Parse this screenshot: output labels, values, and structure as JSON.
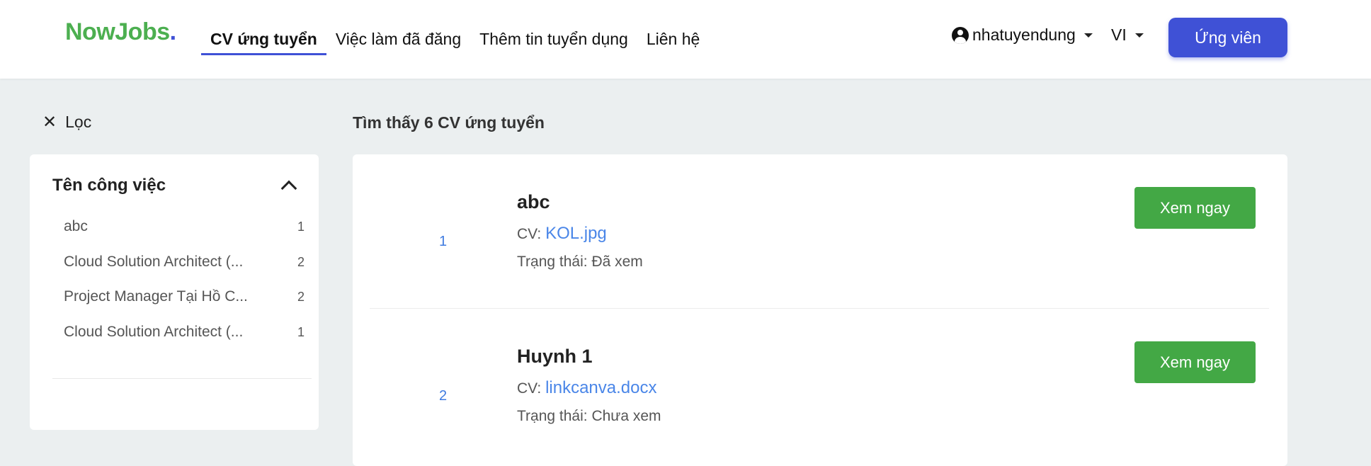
{
  "header": {
    "logo_part1": "NowJobs",
    "logo_part2": ".",
    "nav": [
      {
        "label": "CV ứng tuyển",
        "active": true
      },
      {
        "label": "Việc làm đã đăng",
        "active": false
      },
      {
        "label": "Thêm tin tuyển dụng",
        "active": false
      },
      {
        "label": "Liên hệ",
        "active": false
      }
    ],
    "user": {
      "name": "nhatuyendung",
      "icon": "user-circle-icon"
    },
    "language": "VI",
    "candidate_button": "Ứng viên"
  },
  "filter": {
    "toggle_label": "Lọc",
    "section_title": "Tên công việc",
    "items": [
      {
        "label": "abc",
        "count": "1"
      },
      {
        "label": "Cloud Solution Architect (...",
        "count": "2"
      },
      {
        "label": "Project Manager Tại Hồ C...",
        "count": "2"
      },
      {
        "label": "Cloud Solution Architect (...",
        "count": "1"
      }
    ]
  },
  "results": {
    "count_text": "Tìm thấy 6 CV ứng tuyển",
    "items": [
      {
        "index": "1",
        "name": "abc",
        "cv_prefix": "CV: ",
        "cv_file": "KOL.jpg",
        "status": "Trạng thái: Đã xem",
        "action": "Xem ngay"
      },
      {
        "index": "2",
        "name": "Huynh 1",
        "cv_prefix": "CV: ",
        "cv_file": "linkcanva.docx",
        "status": "Trạng thái: Chưa xem",
        "action": "Xem ngay"
      }
    ]
  },
  "colors": {
    "brand_blue": "#3f51d6",
    "brand_green": "#4caf50",
    "action_green": "#43a845",
    "link_blue": "#4a86e8",
    "background": "#ebeff0"
  }
}
